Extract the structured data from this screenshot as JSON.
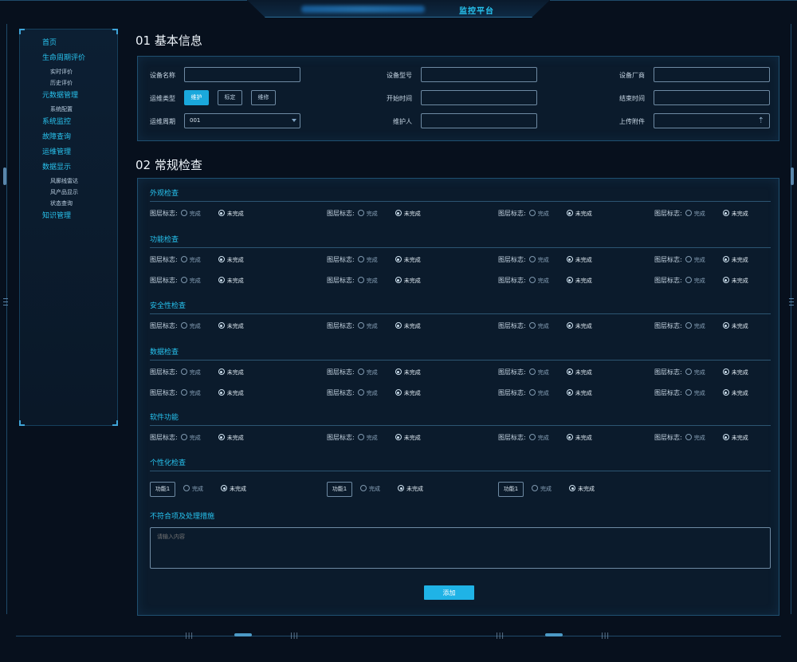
{
  "header": {
    "title": "监控平台"
  },
  "sidebar": {
    "items": [
      {
        "label": "首页",
        "level": 1
      },
      {
        "label": "生命周期评价",
        "level": 1
      },
      {
        "label": "实时评价",
        "level": 2
      },
      {
        "label": "历史评价",
        "level": 2
      },
      {
        "label": "元数据管理",
        "level": 1
      },
      {
        "label": "系统配置",
        "level": 2
      },
      {
        "label": "系统监控",
        "level": 1
      },
      {
        "label": "故障查询",
        "level": 1
      },
      {
        "label": "运维管理",
        "level": 1
      },
      {
        "label": "数据显示",
        "level": 1
      },
      {
        "label": "风廓线雷达",
        "level": 2
      },
      {
        "label": "风产品显示",
        "level": 2
      },
      {
        "label": "状态查询",
        "level": 2
      },
      {
        "label": "知识管理",
        "level": 1
      }
    ]
  },
  "basic": {
    "title": "01 基本信息",
    "device_name_label": "设备名称",
    "device_model_label": "设备型号",
    "vendor_label": "设备厂商",
    "type_label": "运维类型",
    "type_options": [
      "维护",
      "标定",
      "维修"
    ],
    "type_selected": "维护",
    "start_label": "开始时间",
    "end_label": "结束时间",
    "period_label": "运维周期",
    "period_value": "001",
    "person_label": "维护人",
    "attach_label": "上传附件"
  },
  "routine": {
    "title": "02 常规检查",
    "check_label": "图层标志:",
    "opt_done": "完成",
    "opt_undone": "未完成",
    "groups": [
      {
        "title": "外观检查"
      },
      {
        "title": "功能检查"
      },
      {
        "title": "安全性检查"
      },
      {
        "title": "数据检查"
      },
      {
        "title": "软件功能"
      },
      {
        "title": "个性化检查"
      }
    ],
    "func_label": "功能1",
    "issue_title": "不符合项及处理措施",
    "issue_placeholder": "请输入内容",
    "add_label": "添加"
  },
  "colors": {
    "accent": "#27c3ef",
    "button": "#1fb3e6",
    "background": "#07101d"
  },
  "icons": {
    "select": "chevron-down-icon",
    "upload": "upload-icon"
  }
}
